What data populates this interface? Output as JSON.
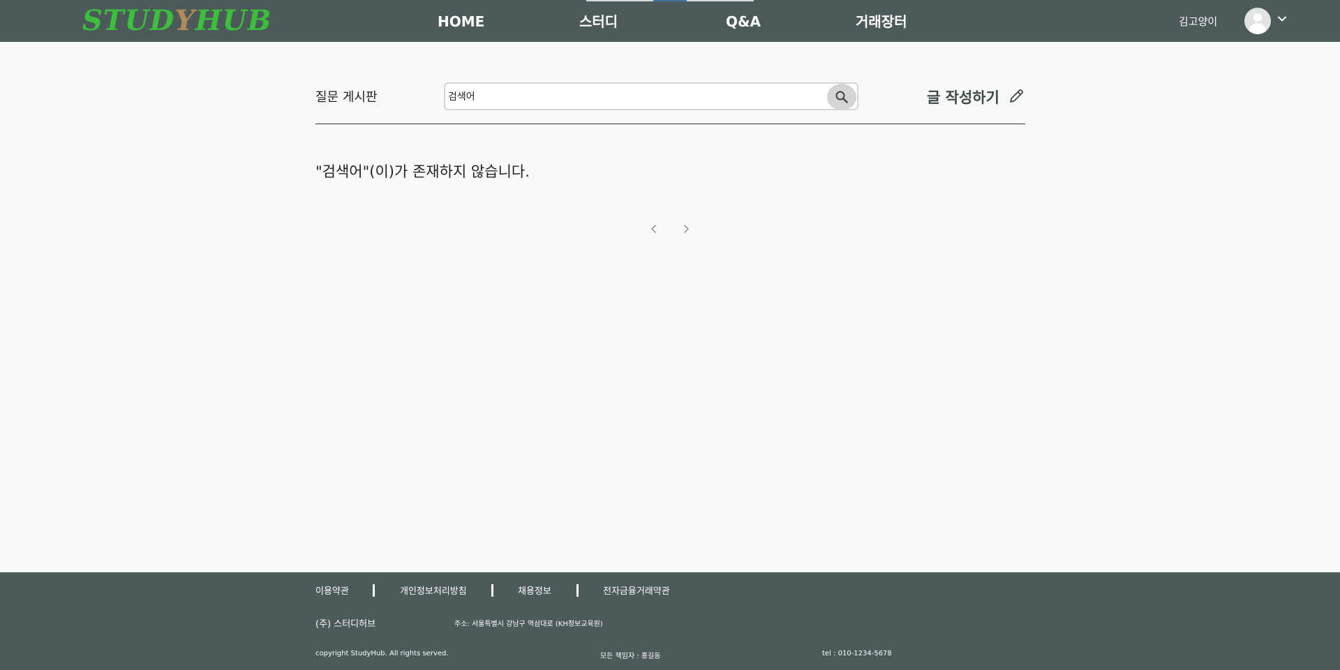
{
  "header": {
    "logo": {
      "part1": "STUD",
      "part2": "Y",
      "part3": "HUB"
    },
    "nav": [
      {
        "label": "HOME"
      },
      {
        "label": "스터디"
      },
      {
        "label": "Q&A"
      },
      {
        "label": "거래장터"
      }
    ],
    "active_tab": "스터디",
    "user_name": "김고양이",
    "avatar_icon": "user-avatar-icon",
    "menu_icon": "chevron-down-icon"
  },
  "board": {
    "title": "질문 게시판",
    "search": {
      "value": "검색어",
      "placeholder": ""
    },
    "search_icon": "search-icon",
    "write_label": "글 작성하기",
    "write_icon": "pencil-icon",
    "empty_message": "\"검색어\"(이)가 존재하지 않습니다.",
    "pagination": {
      "prev_icon": "chevron-left-icon",
      "next_icon": "chevron-right-icon"
    }
  },
  "footer": {
    "links": [
      "이용약관",
      "개인정보처리방침",
      "채용정보",
      "전자금융거래약관"
    ],
    "company": "(주) 스터디허브",
    "address": "주소: 서울특별시 강남구 역삼대로 (KH정보교육원)",
    "copyright": "copyright StudyHub. All rights served.",
    "manager": "모든 책임자 : 홍길동",
    "tel": "tel : 010-1234-5678"
  },
  "colors": {
    "header_bg": "#4c5a5a",
    "logo_green": "#3cbf3c",
    "logo_brown": "#b08a5a",
    "page_bg": "#f9f9f9",
    "active_indicator": "#3f74a8"
  }
}
